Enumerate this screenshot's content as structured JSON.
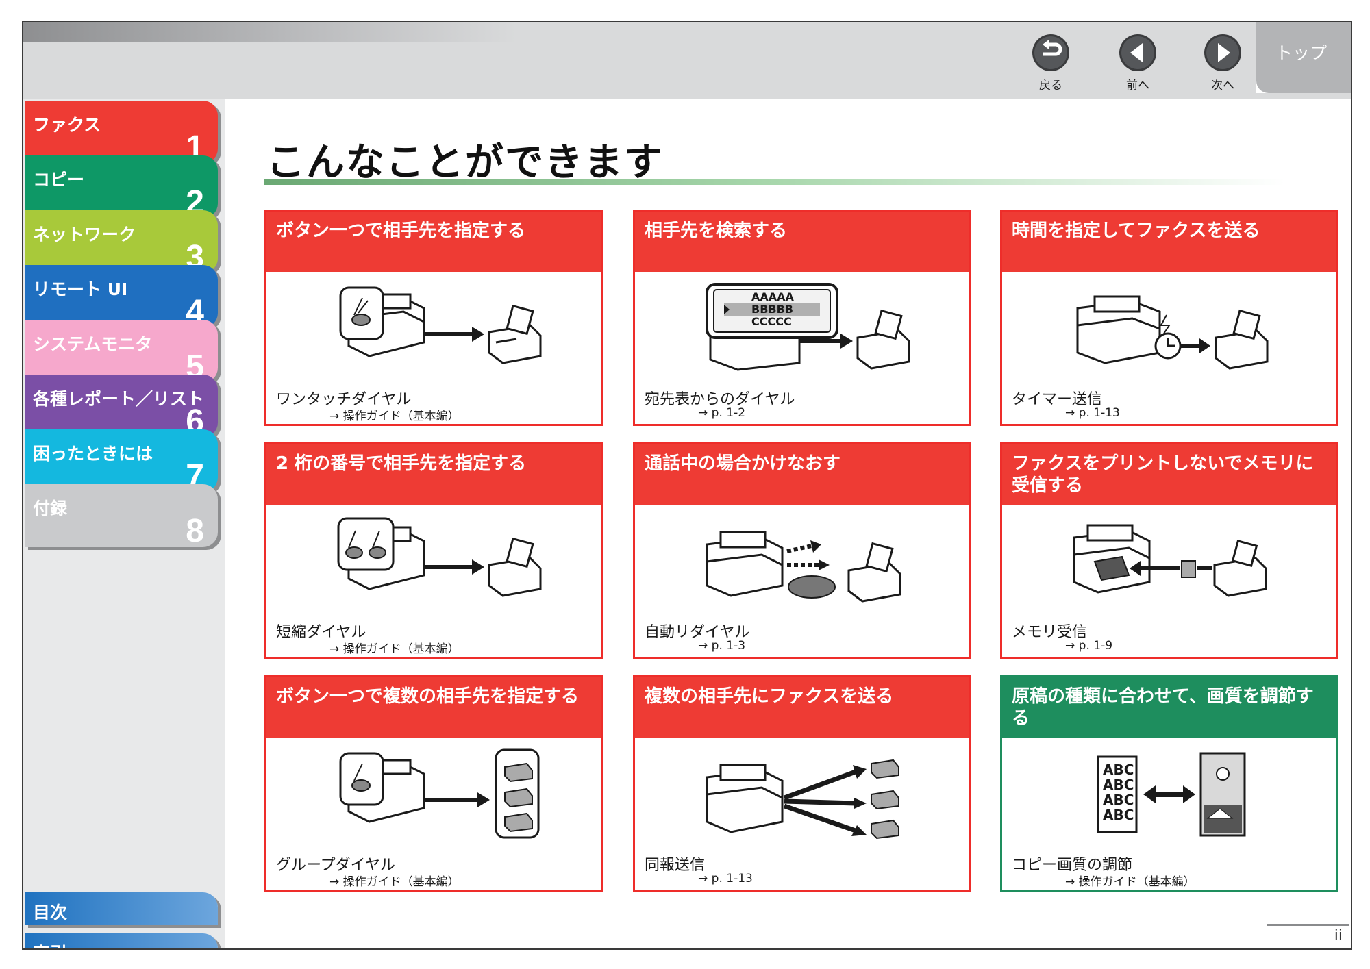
{
  "nav": {
    "back_label": "戻る",
    "prev_label": "前へ",
    "next_label": "次へ",
    "top_label": "トップ"
  },
  "sidebar": {
    "chapters": [
      {
        "label": "ファクス",
        "number": "1",
        "color": "#ee3b34"
      },
      {
        "label": "コピー",
        "number": "2",
        "color": "#0e9866"
      },
      {
        "label": "ネットワーク",
        "number": "3",
        "color": "#a8c93a"
      },
      {
        "label": "リモート UI",
        "number": "4",
        "color": "#1f6fc0"
      },
      {
        "label": "システムモニタ",
        "number": "5",
        "color": "#f6a8cc"
      },
      {
        "label": "各種レポート／リスト",
        "number": "6",
        "color": "#7b4fa6"
      },
      {
        "label": "困ったときには",
        "number": "7",
        "color": "#14b8df"
      },
      {
        "label": "付録",
        "number": "8",
        "color": "#c9cacc"
      }
    ],
    "contents_label": "目次",
    "index_label": "索引"
  },
  "main": {
    "title": "こんなことができます",
    "cards": [
      {
        "heading": "ボタン一つで相手先を指定する",
        "name": "ワンタッチダイヤル",
        "ref": "→ 操作ガイド（基本編）",
        "color": "red",
        "icon": "one-touch-dial-icon"
      },
      {
        "heading": "相手先を検索する",
        "name": "宛先表からのダイヤル",
        "ref": "→ p. 1-2",
        "color": "red",
        "icon": "address-book-dial-icon"
      },
      {
        "heading": "時間を指定してファクスを送る",
        "name": "タイマー送信",
        "ref": "→ p. 1-13",
        "color": "red",
        "icon": "timer-send-icon"
      },
      {
        "heading": "2 桁の番号で相手先を指定する",
        "name": "短縮ダイヤル",
        "ref": "→ 操作ガイド（基本編）",
        "color": "red",
        "icon": "coded-dial-icon"
      },
      {
        "heading": "通話中の場合かけなおす",
        "name": "自動リダイヤル",
        "ref": "→ p. 1-3",
        "color": "red",
        "icon": "auto-redial-icon"
      },
      {
        "heading": "ファクスをプリントしないでメモリに受信する",
        "name": "メモリ受信",
        "ref": "→ p. 1-9",
        "color": "red",
        "icon": "memory-receive-icon"
      },
      {
        "heading": "ボタン一つで複数の相手先を指定する",
        "name": "グループダイヤル",
        "ref": "→ 操作ガイド（基本編）",
        "color": "red",
        "icon": "group-dial-icon"
      },
      {
        "heading": "複数の相手先にファクスを送る",
        "name": "同報送信",
        "ref": "→ p. 1-13",
        "color": "red",
        "icon": "broadcast-send-icon"
      },
      {
        "heading": "原稿の種類に合わせて、画質を調節する",
        "name": "コピー画質の調節",
        "ref": "→ 操作ガイド（基本編）",
        "color": "green",
        "icon": "image-quality-icon"
      }
    ],
    "lcd_lines": [
      "AAAAA",
      "BBBBB",
      "CCCCC"
    ],
    "abc_lines": [
      "ABC",
      "ABC",
      "ABC",
      "ABC"
    ]
  },
  "page_number": "ii"
}
